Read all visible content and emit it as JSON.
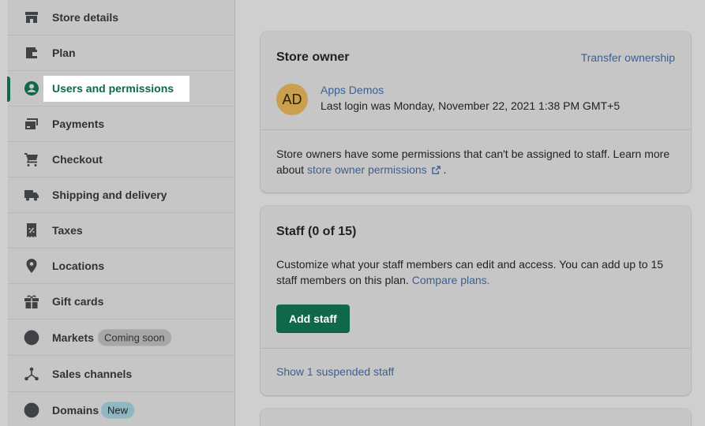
{
  "sidebar": {
    "items": [
      {
        "label": "Store details",
        "icon": "store-icon"
      },
      {
        "label": "Plan",
        "icon": "wallet-icon"
      },
      {
        "label": "Users and permissions",
        "icon": "user-circle-icon",
        "active": true
      },
      {
        "label": "Payments",
        "icon": "payment-card-icon"
      },
      {
        "label": "Checkout",
        "icon": "cart-icon"
      },
      {
        "label": "Shipping and delivery",
        "icon": "truck-icon"
      },
      {
        "label": "Taxes",
        "icon": "receipt-icon"
      },
      {
        "label": "Locations",
        "icon": "location-pin-icon"
      },
      {
        "label": "Gift cards",
        "icon": "gift-icon"
      },
      {
        "label": "Markets",
        "icon": "globe-icon",
        "badge": "Coming soon"
      },
      {
        "label": "Sales channels",
        "icon": "channels-icon"
      },
      {
        "label": "Domains",
        "icon": "globe-icon",
        "badge": "New"
      }
    ]
  },
  "store_owner": {
    "title": "Store owner",
    "transfer_link": "Transfer ownership",
    "avatar_initials": "AD",
    "owner_name": "Apps Demos",
    "last_login": "Last login was Monday, November 22, 2021 1:38 PM GMT+5",
    "permissions_text": "Store owners have some permissions that can't be assigned to staff. Learn more about",
    "permissions_link": "store owner permissions",
    "permissions_suffix": "."
  },
  "staff": {
    "title": "Staff (0 of 15)",
    "description": "Customize what your staff members can edit and access. You can add up to 15 staff members on this plan.",
    "compare_link": "Compare plans.",
    "add_button": "Add staff",
    "suspended_link": "Show 1 suspended staff"
  },
  "colors": {
    "accent_green": "#0f6849",
    "link_blue": "#3a5f96",
    "avatar_gold": "#c9a04f"
  }
}
